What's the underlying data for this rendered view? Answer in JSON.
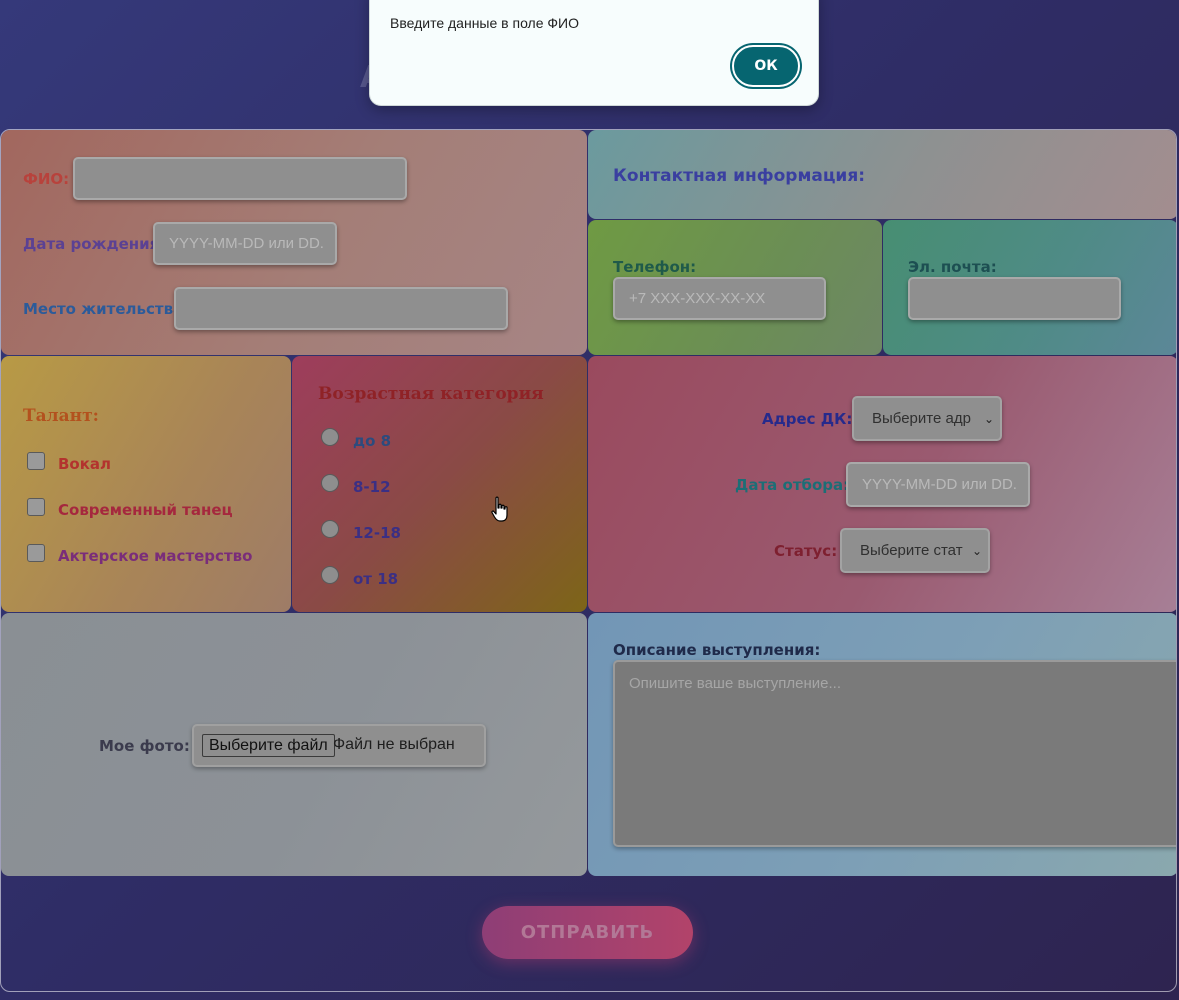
{
  "modal": {
    "message": "Введите данные в поле ФИО",
    "ok_label": "ОК"
  },
  "personal": {
    "fio_label": "ФИО:",
    "fio_value": "",
    "birth_label": "Дата рождения:",
    "birth_placeholder": "YYYY-MM-DD или DD.",
    "residence_label": "Место жительства:",
    "residence_value": ""
  },
  "contact": {
    "heading": "Контактная информация:",
    "phone_label": "Телефон:",
    "phone_placeholder": "+7 XXX-XXX-XX-XX",
    "email_label": "Эл. почта:",
    "email_value": ""
  },
  "talent": {
    "heading": "Талант:",
    "options": [
      "Вокал",
      "Современный танец",
      "Актерское мастерство"
    ]
  },
  "age": {
    "heading": "Возрастная категория",
    "options": [
      "до 8",
      "8-12",
      "12-18",
      "от 18"
    ]
  },
  "selection": {
    "address_label": "Адрес ДК:",
    "address_selected": "Выберите адр",
    "date_label": "Дата отбора:",
    "date_placeholder": "YYYY-MM-DD или DD.",
    "status_label": "Статус:",
    "status_selected": "Выберите стат"
  },
  "photo": {
    "label": "Мое фото:",
    "button_label": "Выберите файл",
    "file_status": "Файл не выбран"
  },
  "description": {
    "label": "Описание выступления:",
    "placeholder": "Опишите ваше выступление..."
  },
  "submit_label": "ОТПРАВИТЬ",
  "colors": {
    "ok_button": "#066570",
    "submit_button": "#b2436a"
  }
}
